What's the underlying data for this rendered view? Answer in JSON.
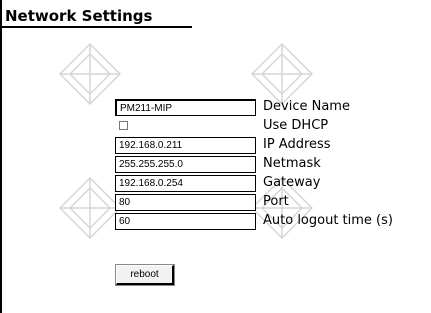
{
  "page": {
    "title": "Network Settings"
  },
  "form": {
    "device_name": {
      "value": "PM211-MIP",
      "label": "Device Name"
    },
    "use_dhcp": {
      "checked": false,
      "label": "Use DHCP"
    },
    "ip_address": {
      "value": "192.168.0.211",
      "label": "IP Address"
    },
    "netmask": {
      "value": "255.255.255.0",
      "label": "Netmask"
    },
    "gateway": {
      "value": "192.168.0.254",
      "label": "Gateway"
    },
    "port": {
      "value": "80",
      "label": "Port"
    },
    "auto_logout": {
      "value": "60",
      "label": "Auto logout time (s)"
    }
  },
  "actions": {
    "reboot_label": "reboot"
  },
  "colors": {
    "watermark": "#d6d6d6"
  }
}
